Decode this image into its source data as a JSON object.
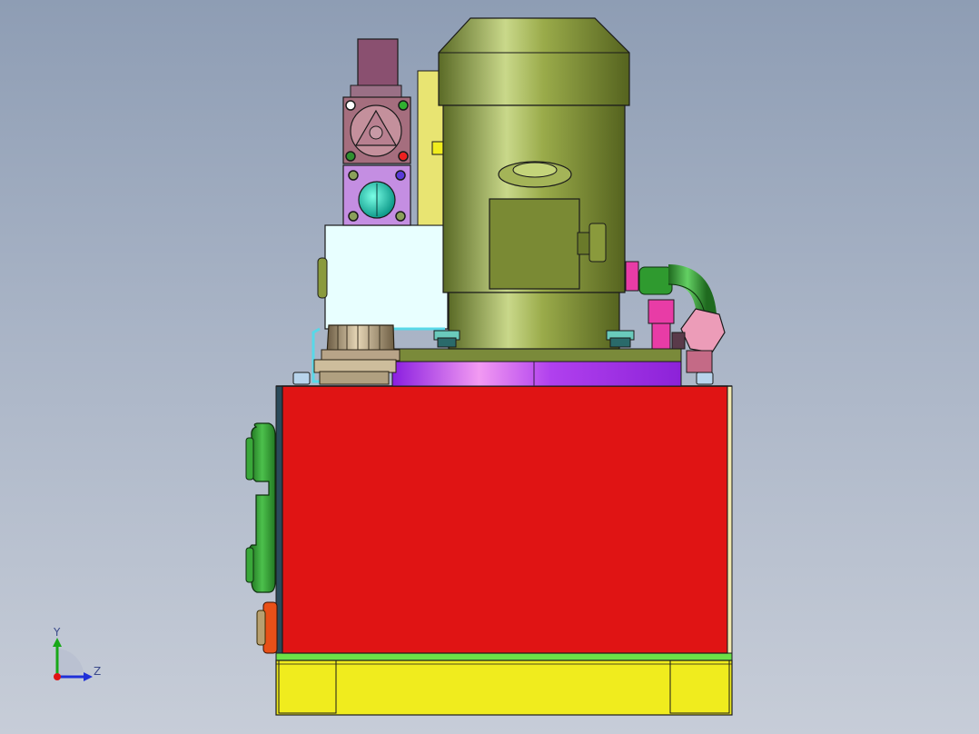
{
  "triad": {
    "y_label": "Y",
    "z_label": "Z"
  },
  "colors": {
    "background_top": "#8e9db4",
    "background_bottom": "#c7cdd8",
    "tank": "#e01414",
    "tank_side": "#f0e8b0",
    "base_frame": "#f0ec1e",
    "base_strip": "#6ce048",
    "motor": "#8a9a3c",
    "adapter_flange": "#a632e8",
    "solenoid_valve": "#a56e7e",
    "pressure_gauge_block": "#c48ee2",
    "manifold_block": "#e8ffff",
    "filler_cap": "#b8a488",
    "side_cover": "#2e9a2e",
    "drain_plug": "#e85018",
    "hose": "#2f8a2f",
    "fitting_magenta": "#e83ca6"
  }
}
